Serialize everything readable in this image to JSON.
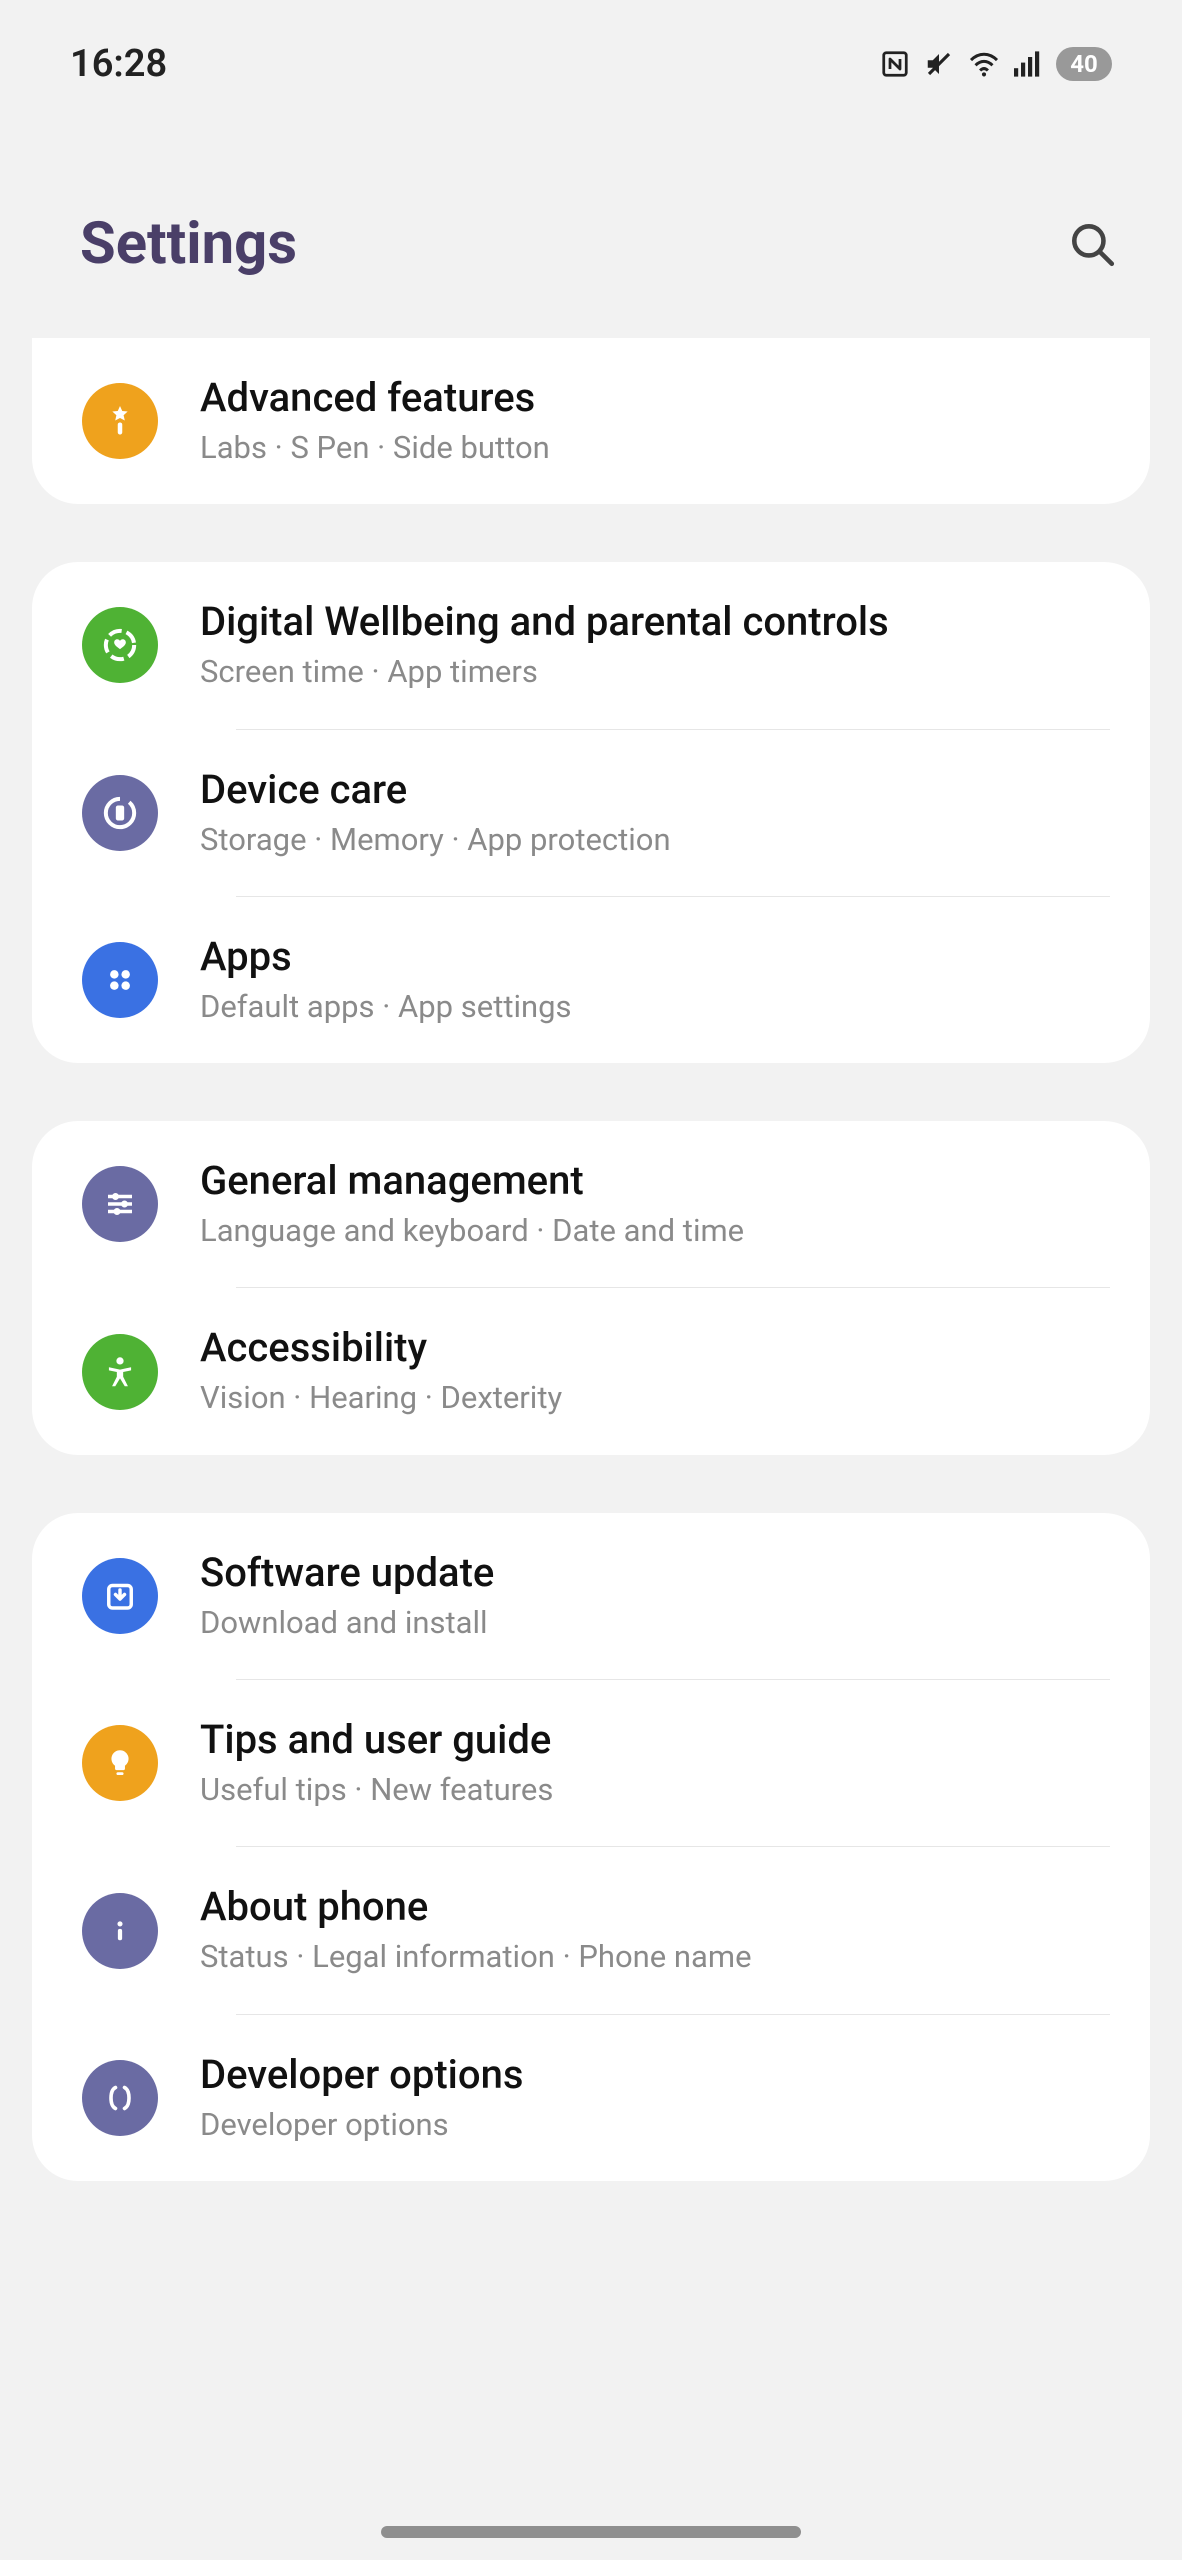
{
  "status": {
    "time": "16:28",
    "battery": "40"
  },
  "header": {
    "title": "Settings"
  },
  "groups": [
    {
      "items": [
        {
          "title": "Advanced features",
          "subtitle": "Labs  ·  S Pen  ·  Side button"
        }
      ]
    },
    {
      "items": [
        {
          "title": "Digital Wellbeing and parental controls",
          "subtitle": "Screen time  ·  App timers"
        },
        {
          "title": "Device care",
          "subtitle": "Storage  ·  Memory  ·  App protection"
        },
        {
          "title": "Apps",
          "subtitle": "Default apps  ·  App settings"
        }
      ]
    },
    {
      "items": [
        {
          "title": "General management",
          "subtitle": "Language and keyboard  ·  Date and time"
        },
        {
          "title": "Accessibility",
          "subtitle": "Vision  ·  Hearing  ·  Dexterity"
        }
      ]
    },
    {
      "items": [
        {
          "title": "Software update",
          "subtitle": "Download and install"
        },
        {
          "title": "Tips and user guide",
          "subtitle": "Useful tips  ·  New features"
        },
        {
          "title": "About phone",
          "subtitle": "Status  ·  Legal information  ·  Phone name"
        },
        {
          "title": "Developer options",
          "subtitle": "Developer options"
        }
      ]
    }
  ]
}
